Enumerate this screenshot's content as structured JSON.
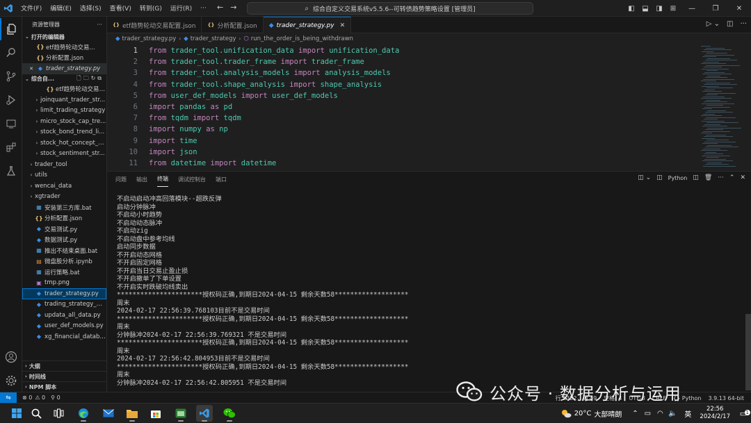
{
  "titlebar": {
    "menu": [
      "文件(F)",
      "编辑(E)",
      "选择(S)",
      "查看(V)",
      "转到(G)",
      "运行(R)",
      "···"
    ],
    "command_center": "综合自定义交易系统v5.5.6--可转债趋势策略设置 [管理员]"
  },
  "sidebar": {
    "header": "资源管理器",
    "open_editors_title": "打开的编辑器",
    "open_editors": [
      {
        "name": "etf趋势轮动交易...",
        "icon": "json"
      },
      {
        "name": "分析配置.json",
        "icon": "json"
      },
      {
        "name": "trader_strategy.py",
        "icon": "py"
      }
    ],
    "workspace_title": "综合自...",
    "tree": [
      {
        "name": "etf趋势轮动交易配...",
        "icon": "json",
        "indent": 2,
        "chev": ""
      },
      {
        "name": "joinquant_trader_str...",
        "icon": "",
        "indent": 1,
        "chev": "›"
      },
      {
        "name": "limit_trading_strategy",
        "icon": "",
        "indent": 1,
        "chev": "›"
      },
      {
        "name": "micro_stock_cap_tre...",
        "icon": "",
        "indent": 1,
        "chev": "›"
      },
      {
        "name": "stock_bond_trend_li...",
        "icon": "",
        "indent": 1,
        "chev": "›"
      },
      {
        "name": "stock_hot_concept_s...",
        "icon": "",
        "indent": 1,
        "chev": "›"
      },
      {
        "name": "stock_sentiment_str...",
        "icon": "",
        "indent": 1,
        "chev": "›"
      },
      {
        "name": "trader_tool",
        "icon": "",
        "indent": 0,
        "chev": "›"
      },
      {
        "name": "utils",
        "icon": "",
        "indent": 0,
        "chev": "›"
      },
      {
        "name": "wencai_data",
        "icon": "",
        "indent": 0,
        "chev": "›"
      },
      {
        "name": "xgtrader",
        "icon": "",
        "indent": 0,
        "chev": "›"
      },
      {
        "name": "安装第三方库.bat",
        "icon": "bat",
        "indent": 0,
        "chev": ""
      },
      {
        "name": "分析配置.json",
        "icon": "json",
        "indent": 0,
        "chev": ""
      },
      {
        "name": "交易测试.py",
        "icon": "py",
        "indent": 0,
        "chev": ""
      },
      {
        "name": "数据测试.py",
        "icon": "py",
        "indent": 0,
        "chev": ""
      },
      {
        "name": "推出不结束桌面.bat",
        "icon": "bat",
        "indent": 0,
        "chev": ""
      },
      {
        "name": "微盘股分析.ipynb",
        "icon": "nb",
        "indent": 0,
        "chev": ""
      },
      {
        "name": "运行策略.bat",
        "icon": "bat",
        "indent": 0,
        "chev": ""
      },
      {
        "name": "tmp.png",
        "icon": "img",
        "indent": 0,
        "chev": ""
      },
      {
        "name": "trader_strategy.py",
        "icon": "py",
        "indent": 0,
        "chev": "",
        "selected": true
      },
      {
        "name": "trading_strategy_mod...",
        "icon": "py",
        "indent": 0,
        "chev": ""
      },
      {
        "name": "updata_all_data.py",
        "icon": "py",
        "indent": 0,
        "chev": ""
      },
      {
        "name": "user_def_models.py",
        "icon": "py",
        "indent": 0,
        "chev": ""
      },
      {
        "name": "xg_financial_database...",
        "icon": "py",
        "indent": 0,
        "chev": ""
      }
    ],
    "bottom_sections": [
      "大纲",
      "时间线",
      "NPM 脚本"
    ]
  },
  "editor": {
    "tabs": [
      {
        "label": "etf趋势轮动交易配置.json",
        "icon": "json",
        "active": false
      },
      {
        "label": "分析配置.json",
        "icon": "json",
        "active": false
      },
      {
        "label": "trader_strategy.py",
        "icon": "py",
        "active": true
      }
    ],
    "breadcrumb": [
      "trader_strategy.py",
      "trader_strategy",
      "run_the_order_is_being_withdrawn"
    ],
    "lines": [
      {
        "n": "1",
        "tokens": [
          [
            "kw",
            "from "
          ],
          [
            "mod",
            "trader_tool.unification_data "
          ],
          [
            "kw",
            "import "
          ],
          [
            "mod",
            "unification_data"
          ]
        ]
      },
      {
        "n": "2",
        "tokens": [
          [
            "kw",
            "from "
          ],
          [
            "mod",
            "trader_tool.trader_frame "
          ],
          [
            "kw",
            "import "
          ],
          [
            "mod",
            "trader_frame"
          ]
        ]
      },
      {
        "n": "3",
        "tokens": [
          [
            "kw",
            "from "
          ],
          [
            "mod",
            "trader_tool.analysis_models "
          ],
          [
            "kw",
            "import "
          ],
          [
            "mod",
            "analysis_models"
          ]
        ]
      },
      {
        "n": "4",
        "tokens": [
          [
            "kw",
            "from "
          ],
          [
            "mod",
            "trader_tool.shape_analysis "
          ],
          [
            "kw",
            "import "
          ],
          [
            "mod",
            "shape_analysis"
          ]
        ]
      },
      {
        "n": "5",
        "tokens": [
          [
            "kw",
            "from "
          ],
          [
            "mod",
            "user_def_models "
          ],
          [
            "kw",
            "import "
          ],
          [
            "mod",
            "user_def_models"
          ]
        ]
      },
      {
        "n": "6",
        "tokens": [
          [
            "kw",
            "import "
          ],
          [
            "mod",
            "pandas "
          ],
          [
            "kw",
            "as "
          ],
          [
            "mod",
            "pd"
          ]
        ]
      },
      {
        "n": "7",
        "tokens": [
          [
            "kw",
            "from "
          ],
          [
            "mod",
            "tqdm "
          ],
          [
            "kw",
            "import "
          ],
          [
            "mod",
            "tqdm"
          ]
        ]
      },
      {
        "n": "8",
        "tokens": [
          [
            "kw",
            "import "
          ],
          [
            "mod",
            "numpy "
          ],
          [
            "kw",
            "as "
          ],
          [
            "mod",
            "np"
          ]
        ]
      },
      {
        "n": "9",
        "tokens": [
          [
            "kw",
            "import "
          ],
          [
            "mod",
            "time"
          ]
        ]
      },
      {
        "n": "10",
        "tokens": [
          [
            "kw",
            "import "
          ],
          [
            "mod",
            "json"
          ]
        ]
      },
      {
        "n": "11",
        "tokens": [
          [
            "kw",
            "from "
          ],
          [
            "mod",
            "datetime "
          ],
          [
            "kw",
            "import "
          ],
          [
            "mod",
            "datetime"
          ]
        ]
      }
    ]
  },
  "panel": {
    "tabs": [
      "问题",
      "输出",
      "终端",
      "调试控制台",
      "端口"
    ],
    "active_tab": "终端",
    "terminal_kind": "Python",
    "terminal_lines": [
      "不启动启动冲高回落模块--超跌反弹",
      "启动分钟脉冲",
      "不启动小时趋势",
      "不启动动态脉冲",
      "不启动zig",
      "不启动盘中参考均线",
      "启动同步数据",
      "不开启动态网格",
      "不开启固定网格",
      "不开启当日交易止盈止损",
      "不开启撤单了下单设置",
      "不开启实时跌破均线卖出",
      "**********************授权码正确,到期日2024-04-15 剩余天数58*******************",
      "周末",
      "2024-02-17 22:56:39.768103目前不是交易时间",
      "**********************授权码正确,到期日2024-04-15 剩余天数58*******************",
      "周末",
      "分钟脉冲2024-02-17 22:56:39.769321 不是交易时间",
      "**********************授权码正确,到期日2024-04-15 剩余天数58*******************",
      "周末",
      "2024-02-17 22:56:42.804953目前不是交易时间",
      "**********************授权码正确,到期日2024-04-15 剩余天数58*******************",
      "周末",
      "分钟脉冲2024-02-17 22:56:42.805951 不是交易时间"
    ]
  },
  "statusbar": {
    "errors": "⊗ 0",
    "warnings": "⚠ 0",
    "ports": "0",
    "right": [
      "行 2352，列 49",
      "空格: 4",
      "UTF-8",
      "CRLF",
      "{} Python",
      "3.9.13 64-bit"
    ]
  },
  "watermark": "公众号 · 数据分析与运用",
  "taskbar": {
    "weather_temp": "20°C",
    "weather_text": "大部晴朗",
    "ime": "英",
    "time": "22:56",
    "date": "2024/2/17",
    "notif_count": "1"
  },
  "colors": {
    "accent": "#0078d4",
    "keyword": "#c586c0",
    "module": "#4ec9b0"
  }
}
